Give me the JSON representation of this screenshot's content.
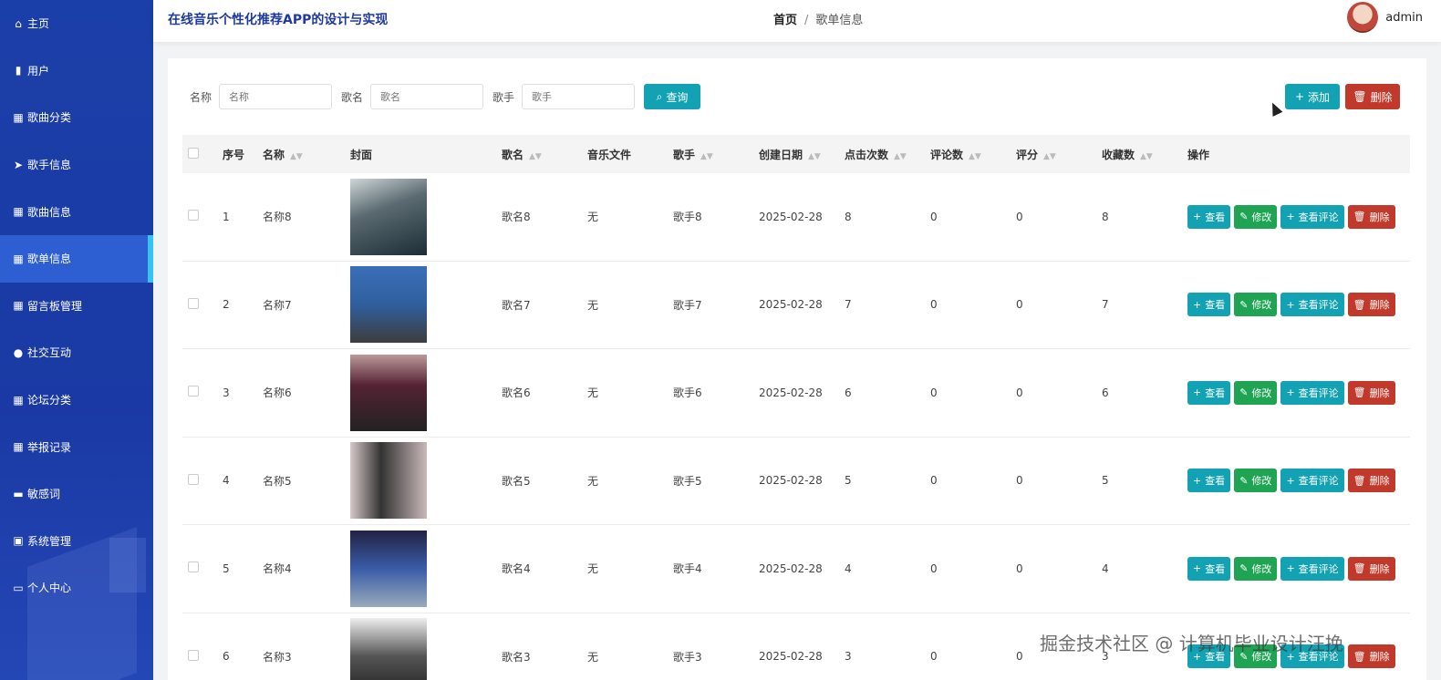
{
  "sidebar": {
    "items": [
      {
        "label": "主页",
        "icon": "home-icon",
        "glyph": "⌂"
      },
      {
        "label": "用户",
        "icon": "users-icon",
        "glyph": "▮"
      },
      {
        "label": "歌曲分类",
        "icon": "grid-icon",
        "glyph": "▦"
      },
      {
        "label": "歌手信息",
        "icon": "send-icon",
        "glyph": "➤"
      },
      {
        "label": "歌曲信息",
        "icon": "grid-icon",
        "glyph": "▦"
      },
      {
        "label": "歌单信息",
        "icon": "grid-icon",
        "glyph": "▦",
        "active": true
      },
      {
        "label": "留言板管理",
        "icon": "grid-icon",
        "glyph": "▦"
      },
      {
        "label": "社交互动",
        "icon": "user-icon",
        "glyph": "●"
      },
      {
        "label": "论坛分类",
        "icon": "grid-icon",
        "glyph": "▦"
      },
      {
        "label": "举报记录",
        "icon": "grid-icon",
        "glyph": "▦"
      },
      {
        "label": "敏感词",
        "icon": "ticket-icon",
        "glyph": "▬"
      },
      {
        "label": "系统管理",
        "icon": "clipboard-icon",
        "glyph": "▣"
      },
      {
        "label": "个人中心",
        "icon": "card-icon",
        "glyph": "▭"
      }
    ]
  },
  "header": {
    "app_title": "在线音乐个性化推荐APP的设计与实现",
    "breadcrumb_home": "首页",
    "breadcrumb_sep": "/",
    "breadcrumb_current": "歌单信息",
    "user_name": "admin"
  },
  "search": {
    "name_label": "名称",
    "name_placeholder": "名称",
    "song_label": "歌名",
    "song_placeholder": "歌名",
    "singer_label": "歌手",
    "singer_placeholder": "歌手",
    "query_label": "查询"
  },
  "toolbar": {
    "add_label": "添加",
    "delete_label": "删除"
  },
  "table": {
    "headers": {
      "no": "序号",
      "name": "名称",
      "cover": "封面",
      "song": "歌名",
      "file": "音乐文件",
      "singer": "歌手",
      "date": "创建日期",
      "clicks": "点击次数",
      "comments": "评论数",
      "score": "评分",
      "favorites": "收藏数",
      "ops": "操作"
    },
    "actions": {
      "view": "查看",
      "edit": "修改",
      "view_comments": "查看评论",
      "delete": "删除"
    },
    "rows": [
      {
        "no": "1",
        "name": "名称8",
        "song": "歌名8",
        "file": "无",
        "singer": "歌手8",
        "date": "2025-02-28",
        "clicks": "8",
        "comments": "0",
        "score": "0",
        "favorites": "8"
      },
      {
        "no": "2",
        "name": "名称7",
        "song": "歌名7",
        "file": "无",
        "singer": "歌手7",
        "date": "2025-02-28",
        "clicks": "7",
        "comments": "0",
        "score": "0",
        "favorites": "7"
      },
      {
        "no": "3",
        "name": "名称6",
        "song": "歌名6",
        "file": "无",
        "singer": "歌手6",
        "date": "2025-02-28",
        "clicks": "6",
        "comments": "0",
        "score": "0",
        "favorites": "6"
      },
      {
        "no": "4",
        "name": "名称5",
        "song": "歌名5",
        "file": "无",
        "singer": "歌手5",
        "date": "2025-02-28",
        "clicks": "5",
        "comments": "0",
        "score": "0",
        "favorites": "5"
      },
      {
        "no": "5",
        "name": "名称4",
        "song": "歌名4",
        "file": "无",
        "singer": "歌手4",
        "date": "2025-02-28",
        "clicks": "4",
        "comments": "0",
        "score": "0",
        "favorites": "4"
      },
      {
        "no": "6",
        "name": "名称3",
        "song": "歌名3",
        "file": "无",
        "singer": "歌手3",
        "date": "2025-02-28",
        "clicks": "3",
        "comments": "0",
        "score": "0",
        "favorites": "3"
      }
    ]
  },
  "watermark": "掘金技术社区 @ 计算机毕业设计汪挽"
}
